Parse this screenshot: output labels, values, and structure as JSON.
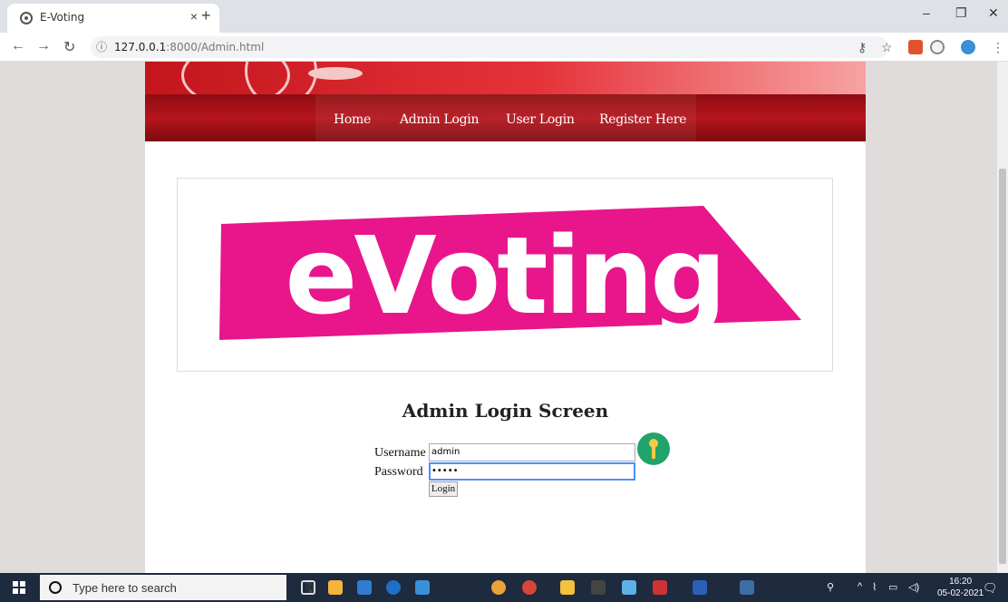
{
  "browser": {
    "tab_title": "E-Voting",
    "url_host": "127.0.0.1",
    "url_path": ":8000/Admin.html"
  },
  "nav": {
    "items": [
      {
        "label": "Home"
      },
      {
        "label": "Admin Login"
      },
      {
        "label": "User Login"
      },
      {
        "label": "Register Here"
      }
    ]
  },
  "logo": {
    "text": "eVoting",
    "color": "#e8168a"
  },
  "login": {
    "heading": "Admin Login Screen",
    "username_label": "Username",
    "username_value": "admin",
    "password_label": "Password",
    "password_value": "•••••",
    "button_label": "Login"
  },
  "taskbar": {
    "search_placeholder": "Type here to search",
    "time": "16:20",
    "date": "05-02-2021"
  },
  "colors": {
    "nav_bg": "#9e1117",
    "banner": "#d92027",
    "page_bg": "#e0dcdc",
    "key_icon_bg": "#21a36c"
  }
}
